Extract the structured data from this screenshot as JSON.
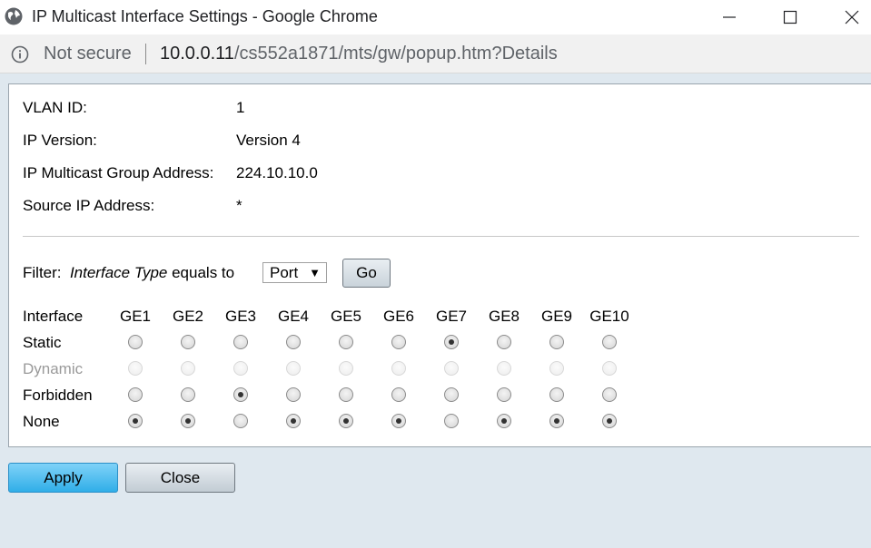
{
  "window": {
    "title": "IP Multicast Interface Settings - Google Chrome",
    "icons": {
      "app": "globe-icon",
      "minimize": "minimize-icon",
      "maximize": "maximize-icon",
      "close": "close-icon"
    }
  },
  "address_bar": {
    "security_label": "Not secure",
    "url_host": "10.0.0.11",
    "url_path": "/cs552a1871/mts/gw/popup.htm?Details"
  },
  "details": {
    "vlan_id_label": "VLAN ID:",
    "vlan_id_value": "1",
    "ip_version_label": "IP Version:",
    "ip_version_value": "Version 4",
    "group_address_label": "IP Multicast Group Address:",
    "group_address_value": "224.10.10.0",
    "source_ip_label": "Source IP Address:",
    "source_ip_value": "*"
  },
  "filter": {
    "label": "Filter:",
    "field": "Interface Type",
    "operator": "equals to",
    "selected": "Port",
    "go_label": "Go"
  },
  "table": {
    "header_label": "Interface",
    "columns": [
      "GE1",
      "GE2",
      "GE3",
      "GE4",
      "GE5",
      "GE6",
      "GE7",
      "GE8",
      "GE9",
      "GE10"
    ],
    "rows": [
      {
        "label": "Static",
        "disabled": false
      },
      {
        "label": "Dynamic",
        "disabled": true
      },
      {
        "label": "Forbidden",
        "disabled": false
      },
      {
        "label": "None",
        "disabled": false
      }
    ],
    "selection": [
      "None",
      "None",
      "Forbidden",
      "None",
      "None",
      "None",
      "Static",
      "None",
      "None",
      "None"
    ]
  },
  "buttons": {
    "apply": "Apply",
    "close": "Close"
  },
  "colors": {
    "apply_bg": "#30aee8",
    "page_bg": "#dfe8ef"
  }
}
